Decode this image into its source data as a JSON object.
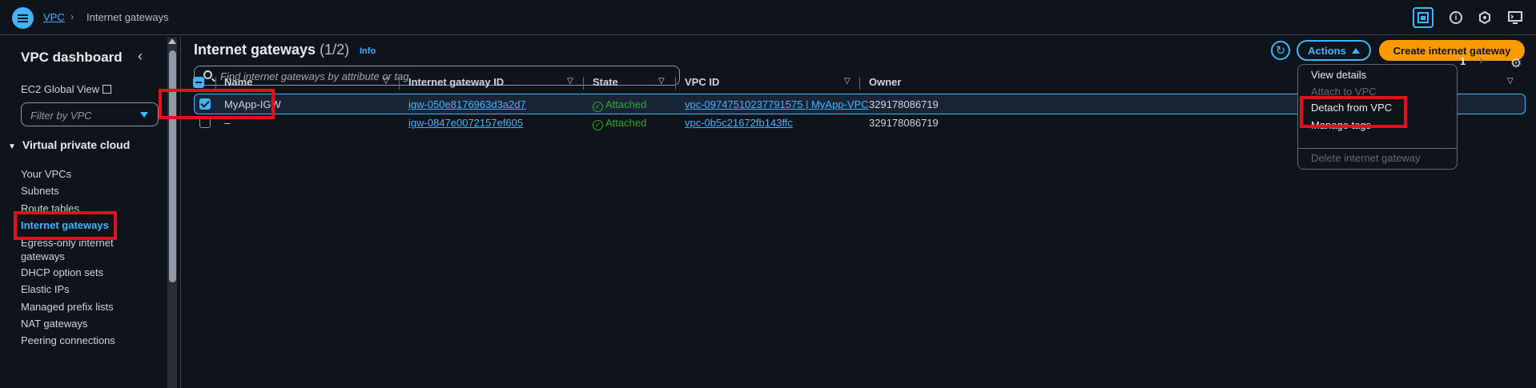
{
  "topbar": {
    "breadcrumb_root": "VPC",
    "breadcrumb_sep": "›",
    "breadcrumb_current": "Internet gateways"
  },
  "sidebar": {
    "title": "VPC dashboard",
    "close_icon": "‹",
    "ec2_global_view": "EC2 Global View",
    "filter_placeholder": "Filter by VPC",
    "section_title": "Virtual private cloud",
    "items": [
      {
        "label": "Your VPCs"
      },
      {
        "label": "Subnets"
      },
      {
        "label": "Route tables"
      },
      {
        "label": "Internet gateways"
      },
      {
        "label": "Egress-only internet gateways"
      },
      {
        "label": "DHCP option sets"
      },
      {
        "label": "Elastic IPs"
      },
      {
        "label": "Managed prefix lists"
      },
      {
        "label": "NAT gateways"
      },
      {
        "label": "Peering connections"
      }
    ]
  },
  "header": {
    "title": "Internet gateways",
    "count": "(1/2)",
    "info": "Info",
    "actions_label": "Actions",
    "create_label": "Create internet gateway",
    "search_placeholder": "Find internet gateways by attribute or tag",
    "page_number": "1"
  },
  "table": {
    "columns": [
      "Name",
      "Internet gateway ID",
      "State",
      "VPC ID",
      "Owner"
    ],
    "rows": [
      {
        "name": "MyApp-IGW",
        "igw_id": "igw-050e8176963d3a2d7",
        "state": "Attached",
        "vpc_id": "vpc-09747510237791575 | MyApp-VPC",
        "owner": "329178086719",
        "selected": true
      },
      {
        "name": "–",
        "igw_id": "igw-0847e0072157ef605",
        "state": "Attached",
        "vpc_id": "vpc-0b5c21672fb143ffc",
        "owner": "329178086719",
        "selected": false
      }
    ]
  },
  "actions_menu": {
    "items": [
      {
        "label": "View details",
        "disabled": false
      },
      {
        "label": "Attach to VPC",
        "disabled": true
      },
      {
        "label": "Detach from VPC",
        "disabled": false
      },
      {
        "label": "Manage tags",
        "disabled": false
      },
      {
        "label": "Delete internet gateway",
        "disabled": true
      }
    ]
  },
  "colors": {
    "accent": "#42b4ff",
    "primary_button": "#ff9900",
    "success": "#29ad32",
    "highlight": "#e5101c"
  }
}
